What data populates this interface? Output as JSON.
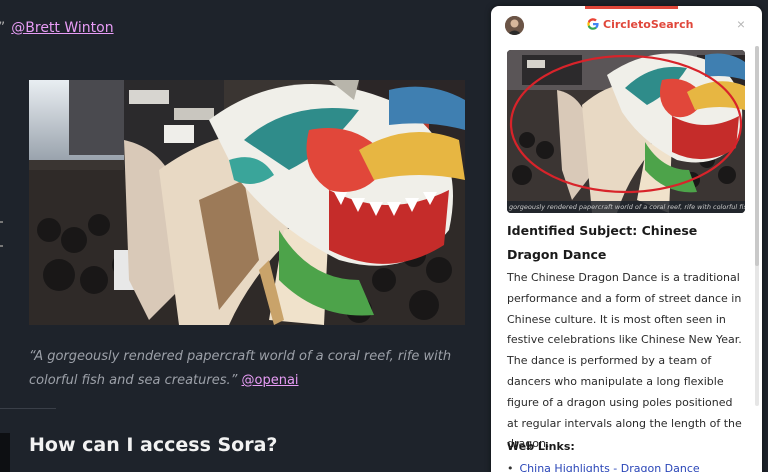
{
  "article": {
    "top_quote_tail": "”",
    "top_handle": "@Brett Winton",
    "caption": "“A gorgeously rendered papercraft world of a coral reef, rife with colorful fish and sea creatures.”",
    "caption_handle": "@openai",
    "section_heading": "How can I access Sora?"
  },
  "panel": {
    "brand": "CircletoSearch",
    "close_icon": "×",
    "image_caption": "gorgeously rendered papercraft world of a coral reef, rife with colorful fish",
    "subject_title": "Identified Subject: Chinese Dragon Dance",
    "description": "The Chinese Dragon Dance is a traditional performance and a form of street dance in Chinese culture. It is most often seen in festive celebrations like Chinese New Year. The dance is performed by a team of dancers who manipulate a long flexible figure of a dragon using poles positioned at regular intervals along the length of the dragon.",
    "links_heading": "Web Links:",
    "links": [
      "China Highlights - Dragon Dance"
    ]
  },
  "colors": {
    "page_bg": "#1e232b",
    "handle_link": "#e79cf5",
    "brand_red": "#e0463a",
    "highlight_circle": "#d8232a",
    "link_blue": "#2a46b8"
  },
  "icons": [
    "g-logo-icon",
    "close-icon",
    "avatar"
  ]
}
